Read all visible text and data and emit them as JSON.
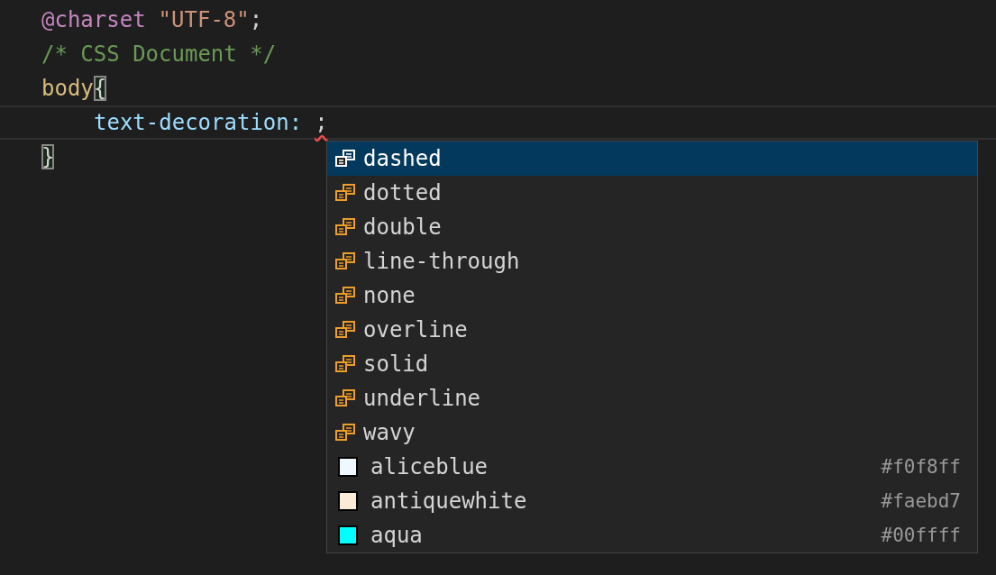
{
  "editor": {
    "lines": [
      {
        "kind": "plain",
        "tokens": [
          {
            "kind": "at-rule",
            "text": "@charset"
          },
          {
            "kind": "string",
            "text": "\"UTF-8\""
          },
          {
            "kind": "punct",
            "text": ";"
          }
        ]
      },
      {
        "kind": "plain",
        "tokens": [
          {
            "kind": "comment",
            "text": "/* CSS Document */"
          }
        ]
      },
      {
        "kind": "plain",
        "tokens": [
          {
            "kind": "selector",
            "text": "body"
          },
          {
            "kind": "bracket",
            "text": "{"
          }
        ],
        "children": [
          {
            "kind": "current",
            "tokens": [
              {
                "kind": "property",
                "text": "text-decoration:"
              },
              {
                "kind": "error",
                "text": ";"
              }
            ]
          }
        ]
      },
      {
        "kind": "plain",
        "tokens": [
          {
            "kind": "bracket",
            "text": "}"
          }
        ]
      }
    ]
  },
  "suggestions": [
    {
      "kind": "value",
      "label": "dashed",
      "selected": true
    },
    {
      "kind": "value",
      "label": "dotted",
      "selected": false
    },
    {
      "kind": "value",
      "label": "double",
      "selected": false
    },
    {
      "kind": "value",
      "label": "line-through",
      "selected": false
    },
    {
      "kind": "value",
      "label": "none",
      "selected": false
    },
    {
      "kind": "value",
      "label": "overline",
      "selected": false
    },
    {
      "kind": "value",
      "label": "solid",
      "selected": false
    },
    {
      "kind": "value",
      "label": "underline",
      "selected": false
    },
    {
      "kind": "value",
      "label": "wavy",
      "selected": false
    },
    {
      "kind": "color",
      "label": "aliceblue",
      "selected": false,
      "color": "#f0f8ff",
      "detail": "#f0f8ff"
    },
    {
      "kind": "color",
      "label": "antiquewhite",
      "selected": false,
      "color": "#faebd7",
      "detail": "#faebd7"
    },
    {
      "kind": "color",
      "label": "aqua",
      "selected": false,
      "color": "#00ffff",
      "detail": "#00ffff"
    }
  ]
}
